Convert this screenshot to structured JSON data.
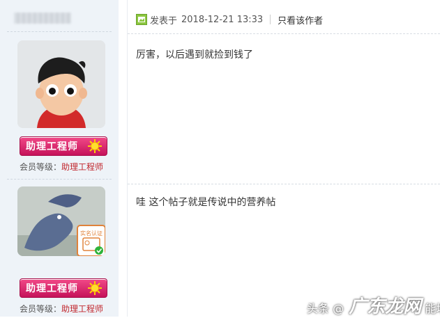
{
  "post1": {
    "posted_prefix": "发表于",
    "posted_time": "2018-12-21 13:33",
    "only_author": "只看该作者",
    "content": "厉害，以后遇到就捡到钱了",
    "user": {
      "rank": "助理工程师",
      "level_label": "会员等级：",
      "level_value": "助理工程师"
    }
  },
  "post2": {
    "content": "哇 这个帖子就是传说中的营养帖",
    "user": {
      "verify_badge_text": "实名认证",
      "rank": "助理工程师",
      "level_label": "会员等级：",
      "level_value": "助理工程师"
    }
  },
  "watermark": {
    "left": "头条",
    "middle": "@",
    "big": "广东龙网",
    "tail": "能培训"
  },
  "colors": {
    "sidebar_bg": "#eef3f8",
    "rank_badge": "#d61c67",
    "level_value": "#c1272d"
  },
  "icons": [
    "post-icon",
    "sun-icon",
    "verified-check-icon"
  ]
}
